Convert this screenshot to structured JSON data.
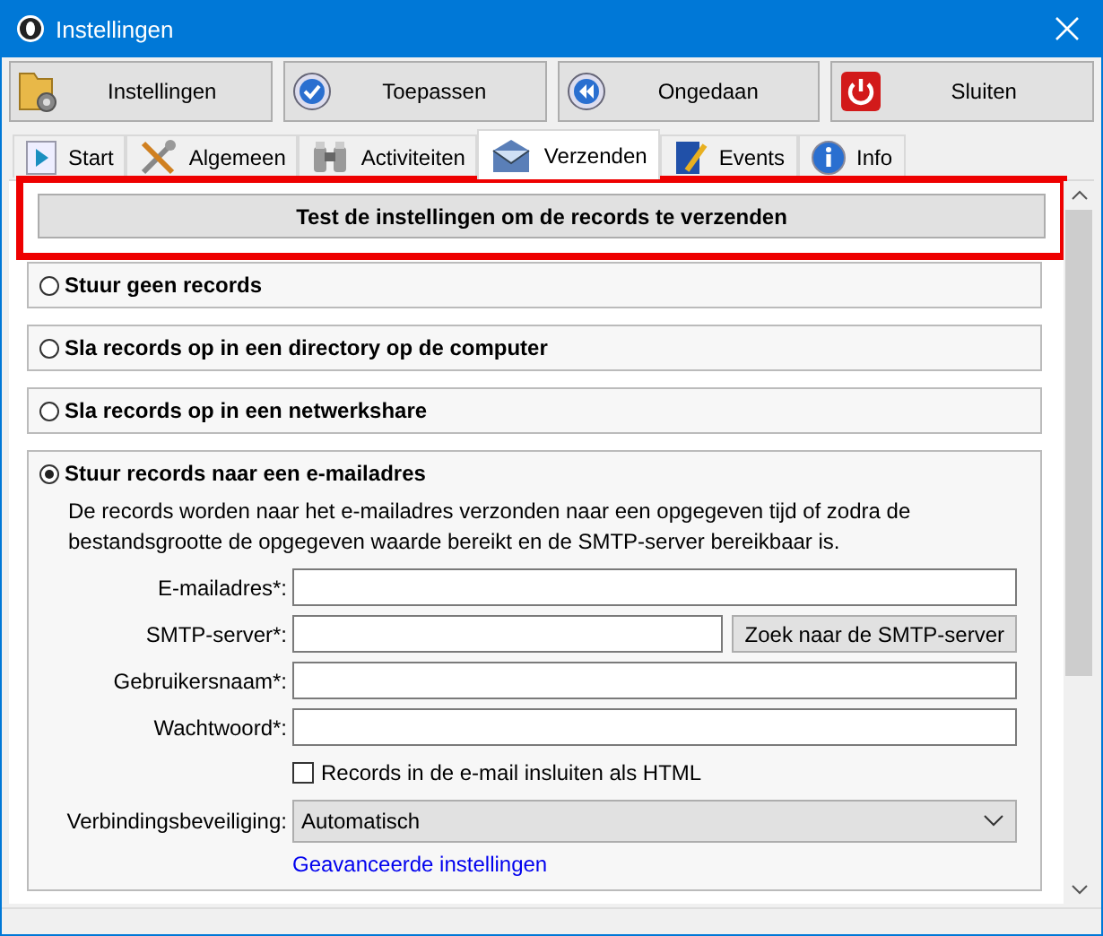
{
  "window": {
    "title": "Instellingen"
  },
  "toolbar": [
    {
      "label": "Instellingen",
      "kind": "folder"
    },
    {
      "label": "Toepassen",
      "kind": "check"
    },
    {
      "label": "Ongedaan",
      "kind": "rewind"
    },
    {
      "label": "Sluiten",
      "kind": "power"
    }
  ],
  "tabs": [
    {
      "label": "Start",
      "kind": "play",
      "selected": false
    },
    {
      "label": "Algemeen",
      "kind": "tools",
      "selected": false
    },
    {
      "label": "Activiteiten",
      "kind": "binoculars",
      "selected": false
    },
    {
      "label": "Verzenden",
      "kind": "mail",
      "selected": true
    },
    {
      "label": "Events",
      "kind": "doc",
      "selected": false
    },
    {
      "label": "Info",
      "kind": "info",
      "selected": false
    }
  ],
  "test_button": {
    "label": "Test de instellingen om de records te verzenden",
    "highlighted": true
  },
  "options": [
    {
      "label": "Stuur geen records",
      "selected": false
    },
    {
      "label": "Sla records op in een directory op de computer",
      "selected": false
    },
    {
      "label": "Sla records op in een netwerkshare",
      "selected": false
    },
    {
      "label": "Stuur records naar een e-mailadres",
      "selected": true
    }
  ],
  "email": {
    "description": "De records worden naar het e-mailadres verzonden naar een opgegeven tijd of zodra de bestandsgrootte de opgegeven waarde bereikt en de SMTP-server bereikbaar is.",
    "fields": [
      {
        "label": "E-mailadres*:"
      },
      {
        "label": "SMTP-server*:",
        "button": "Zoek naar de SMTP-server"
      },
      {
        "label": "Gebruikersnaam*:"
      },
      {
        "label": "Wachtwoord*:"
      }
    ],
    "html_checkbox": {
      "label": "Records in de e-mail insluiten als HTML",
      "checked": false
    },
    "security": {
      "label": "Verbindingsbeveiliging:",
      "value": "Automatisch"
    },
    "advanced_link": "Geavanceerde instellingen"
  }
}
